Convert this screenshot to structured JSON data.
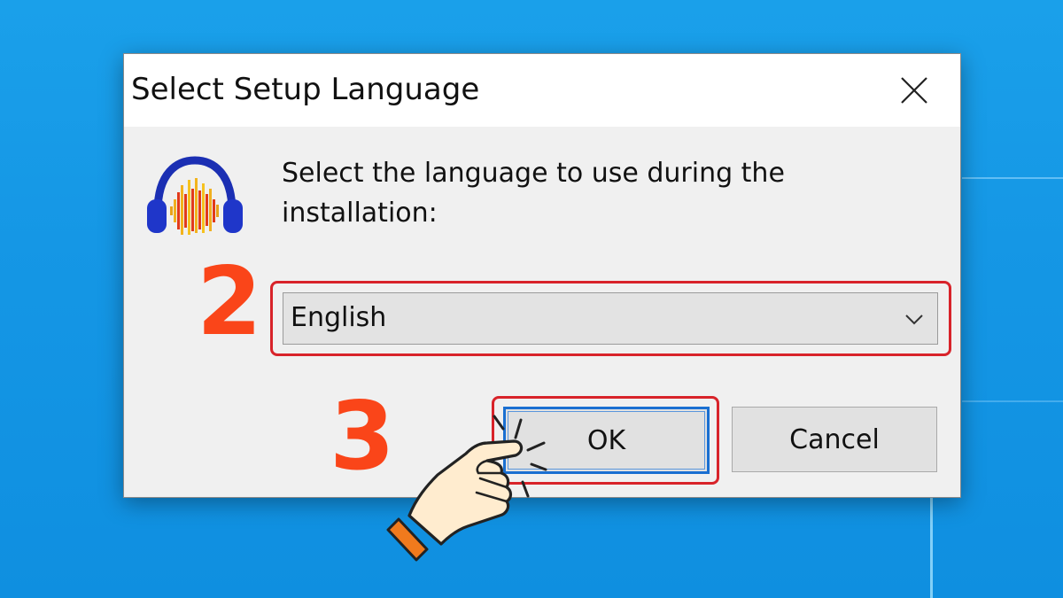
{
  "dialog": {
    "title": "Select Setup Language",
    "prompt": "Select the language to use during the installation:",
    "language_select": {
      "selected": "English"
    },
    "buttons": {
      "ok": "OK",
      "cancel": "Cancel"
    },
    "icons": {
      "close": "close-icon",
      "app": "audacity-headphones-icon",
      "dropdown": "chevron-down-icon"
    }
  },
  "annotations": {
    "step_select": "2",
    "step_ok": "3",
    "highlight_color": "#d8232a",
    "step_color": "#fa4519",
    "pointer_icon": "pointing-hand-icon"
  },
  "colors": {
    "desktop": "#1597e5",
    "dialog_bg": "#f0f0f0",
    "focus_border": "#1a6fd1"
  }
}
